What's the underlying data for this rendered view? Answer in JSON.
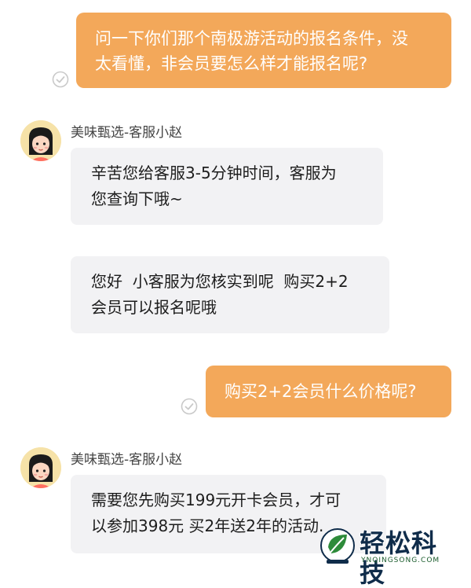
{
  "chat": {
    "msg1": {
      "line1": "问一下你们那个南极游活动的报名条件，没",
      "line2": "太看懂，非会员要怎么样才能报名呢?"
    },
    "agent_name_1": "美味甄选-客服小赵",
    "msg2": {
      "line1": "辛苦您给客服3-5分钟时间，客服为",
      "line2": "您查询下哦~"
    },
    "msg3": {
      "line1": "您好  小客服为您核实到呢  购买2+2",
      "line2": "会员可以报名呢哦"
    },
    "msg4": {
      "line1": "购买2+2会员什么价格呢?"
    },
    "agent_name_2": "美味甄选-客服小赵",
    "msg5": {
      "line1": "需要您先购买199元开卡会员，才可",
      "line2": "以参加398元 买2年送2年的活动."
    }
  },
  "watermark": {
    "brand": "轻松科技",
    "domain": "YNQINGSONG.COM"
  },
  "colors": {
    "outgoing_bubble": "#f3a85a",
    "incoming_bubble": "#f2f2f4",
    "watermark_text": "#0f2c4a"
  }
}
